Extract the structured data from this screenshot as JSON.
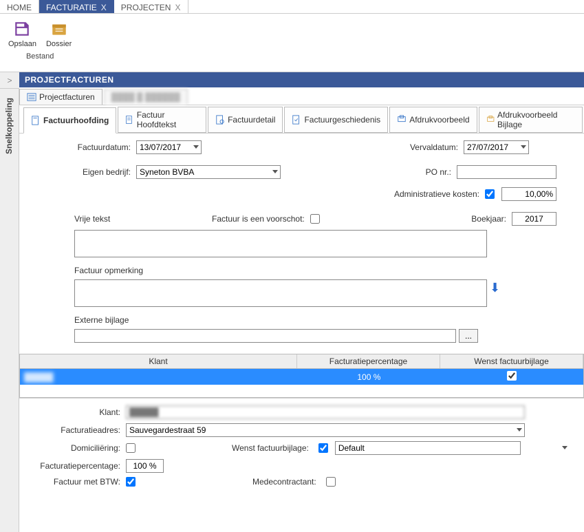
{
  "topTabs": {
    "home": "HOME",
    "facturatie": "FACTURATIE",
    "projecten": "PROJECTEN"
  },
  "ribbon": {
    "opslaan": "Opslaan",
    "dossier": "Dossier",
    "group": "Bestand"
  },
  "pageTitle": "PROJECTFACTUREN",
  "sideTab": "Snelkoppeling",
  "crumbArrow": ">",
  "tabs1": {
    "projectfacturen": "Projectfacturen",
    "second": "████ █ ██████"
  },
  "tabs2": {
    "factuurhoofding": "Factuurhoofding",
    "hoofdtekst": "Factuur Hoofdtekst",
    "factuurdetail": "Factuurdetail",
    "geschiedenis": "Factuurgeschiedenis",
    "afdrukvoorbeeld": "Afdrukvoorbeeld",
    "afdrukvoorbeeldBijlage": "Afdrukvoorbeeld Bijlage"
  },
  "labels": {
    "factuurdatum": "Factuurdatum:",
    "vervaldatum": "Vervaldatum:",
    "eigenBedrijf": "Eigen bedrijf:",
    "poNr": "PO nr.:",
    "adminKosten": "Administratieve kosten:",
    "vrijeTekst": "Vrije tekst",
    "voorschot": "Factuur is een voorschot:",
    "boekjaar": "Boekjaar:",
    "opmerking": "Factuur opmerking",
    "externeBijlage": "Externe bijlage",
    "klant": "Klant:",
    "facturatieadres": "Facturatieadres:",
    "domiciliering": "Domiciliëring:",
    "wenstBijlage": "Wenst factuurbijlage:",
    "facturatiepct": "Facturatiepercentage:",
    "factuurMetBtw": "Factuur met BTW:",
    "medecontractant": "Medecontractant:"
  },
  "values": {
    "factuurdatum": "13/07/2017",
    "vervaldatum": "27/07/2017",
    "eigenBedrijf": "Syneton BVBA",
    "poNr": "",
    "adminKostenChecked": true,
    "adminKostenPct": "10,00%",
    "voorschotChecked": false,
    "boekjaar": "2017",
    "vrijeTekst": "",
    "opmerking": "",
    "externeBijlage": "",
    "klant": "█████",
    "facturatieadres": "Sauvegardestraat 59",
    "domicilieringChecked": false,
    "wenstBijlageChecked": true,
    "wenstBijlageValue": "Default",
    "facturatiepct": "100 %",
    "factuurMetBtwChecked": true,
    "medecontractantChecked": false
  },
  "grid": {
    "headers": {
      "klant": "Klant",
      "pct": "Facturatiepercentage",
      "bijlage": "Wenst factuurbijlage"
    },
    "row": {
      "klant": "█████",
      "pct": "100 %",
      "bijlageChecked": true
    }
  },
  "icons": {
    "browse": "..."
  }
}
